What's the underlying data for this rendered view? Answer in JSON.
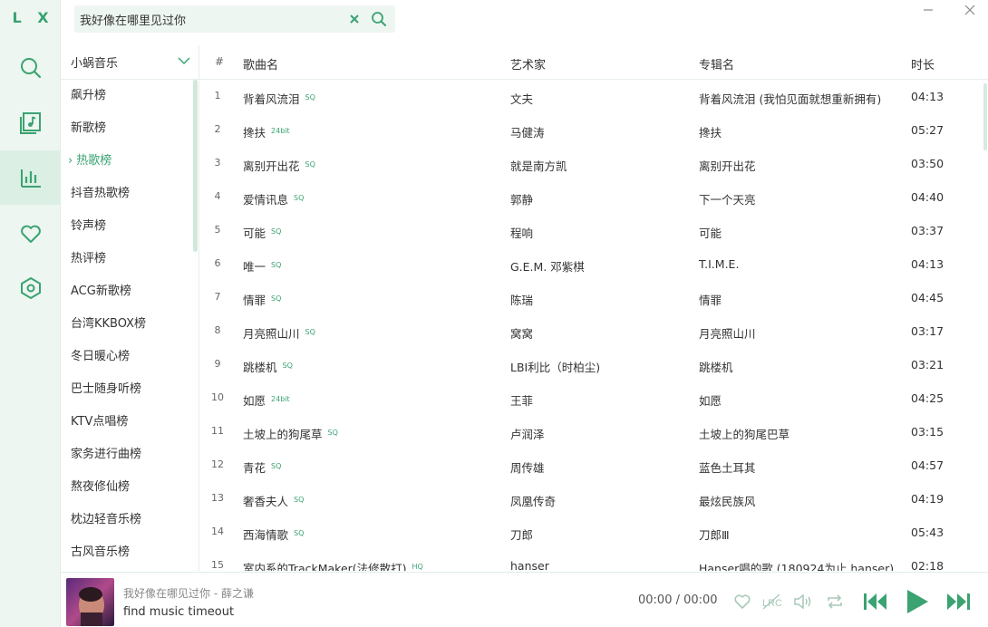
{
  "app": {
    "logo": "L X"
  },
  "rail": {
    "items": [
      {
        "name": "search",
        "icon": "search-icon"
      },
      {
        "name": "playlist",
        "icon": "music-library-icon"
      },
      {
        "name": "leaderboard",
        "icon": "chart-bar-icon",
        "active": true
      },
      {
        "name": "favorites",
        "icon": "heart-icon"
      },
      {
        "name": "settings",
        "icon": "settings-icon"
      }
    ]
  },
  "search": {
    "value": "我好像在哪里见过你"
  },
  "boards": {
    "source": "小蜗音乐",
    "items": [
      "飙升榜",
      "新歌榜",
      "热歌榜",
      "抖音热歌榜",
      "铃声榜",
      "热评榜",
      "ACG新歌榜",
      "台湾KKBOX榜",
      "冬日暖心榜",
      "巴士随身听榜",
      "KTV点唱榜",
      "家务进行曲榜",
      "熬夜修仙榜",
      "枕边轻音乐榜",
      "古风音乐榜"
    ],
    "active_index": 2
  },
  "table": {
    "headers": {
      "num": "#",
      "name": "歌曲名",
      "artist": "艺术家",
      "album": "专辑名",
      "duration": "时长"
    },
    "rows": [
      {
        "num": "1",
        "name": "背着风流泪",
        "badge": "SQ",
        "artist": "文夫",
        "album": "背着风流泪 (我怕见面就想重新拥有)",
        "duration": "04:13"
      },
      {
        "num": "2",
        "name": "搀扶",
        "badge": "24bit",
        "artist": "马健涛",
        "album": "搀扶",
        "duration": "05:27"
      },
      {
        "num": "3",
        "name": "离别开出花",
        "badge": "SQ",
        "artist": "就是南方凯",
        "album": "离别开出花",
        "duration": "03:50"
      },
      {
        "num": "4",
        "name": "爱情讯息",
        "badge": "SQ",
        "artist": "郭静",
        "album": "下一个天亮",
        "duration": "04:40"
      },
      {
        "num": "5",
        "name": "可能",
        "badge": "SQ",
        "artist": "程响",
        "album": "可能",
        "duration": "03:37"
      },
      {
        "num": "6",
        "name": "唯一",
        "badge": "SQ",
        "artist": "G.E.M. 邓紫棋",
        "album": "T.I.M.E.",
        "duration": "04:13"
      },
      {
        "num": "7",
        "name": "情罪",
        "badge": "SQ",
        "artist": "陈瑞",
        "album": "情罪",
        "duration": "04:45"
      },
      {
        "num": "8",
        "name": "月亮照山川",
        "badge": "SQ",
        "artist": "窝窝",
        "album": "月亮照山川",
        "duration": "03:17"
      },
      {
        "num": "9",
        "name": "跳楼机",
        "badge": "SQ",
        "artist": "LBI利比（时柏尘)",
        "album": "跳楼机",
        "duration": "03:21"
      },
      {
        "num": "10",
        "name": "如愿",
        "badge": "24bit",
        "artist": "王菲",
        "album": "如愿",
        "duration": "04:25"
      },
      {
        "num": "11",
        "name": "土坡上的狗尾草",
        "badge": "SQ",
        "artist": "卢润泽",
        "album": "土坡上的狗尾巴草",
        "duration": "03:15"
      },
      {
        "num": "12",
        "name": "青花",
        "badge": "SQ",
        "artist": "周传雄",
        "album": "蓝色土耳其",
        "duration": "04:57"
      },
      {
        "num": "13",
        "name": "奢香夫人",
        "badge": "SQ",
        "artist": "凤凰传奇",
        "album": "最炫民族风",
        "duration": "04:19"
      },
      {
        "num": "14",
        "name": "西海情歌",
        "badge": "SQ",
        "artist": "刀郎",
        "album": "刀郎Ⅲ",
        "duration": "05:43"
      },
      {
        "num": "15",
        "name": "室内系的TrackMaker(法修散打)",
        "badge": "HQ",
        "artist": "hanser",
        "album": "Hanser唱的歌 (180924为止 hanser)",
        "duration": "02:18"
      }
    ]
  },
  "player": {
    "title": "我好像在哪见过你 - 薛之谦",
    "status": "find music timeout",
    "time": "00:00 / 00:00"
  },
  "colors": {
    "accent": "#3aa371",
    "rail_bg": "#eef6f1",
    "rail_active": "#dcefe4"
  }
}
